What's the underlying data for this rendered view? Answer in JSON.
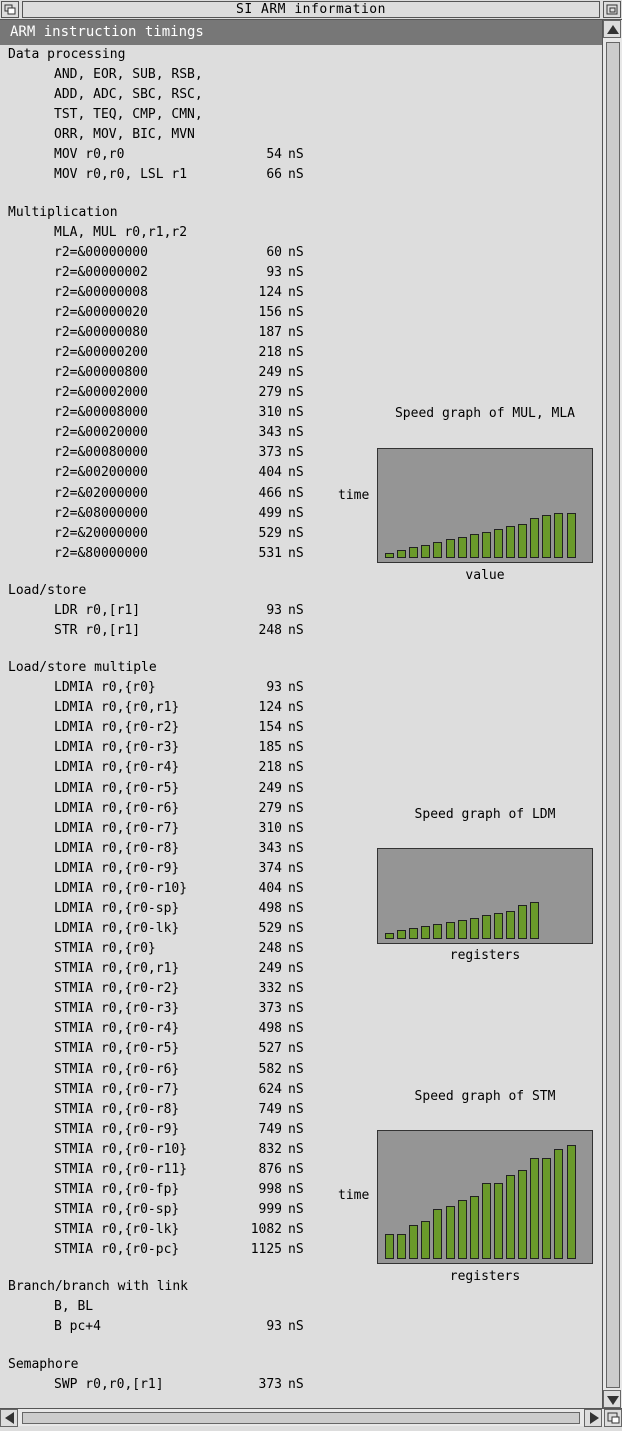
{
  "window": {
    "title": "SI ARM information"
  },
  "header": "ARM instruction timings",
  "unit": "nS",
  "sections": [
    {
      "title": "Data processing",
      "lines": [
        "AND, EOR, SUB, RSB,",
        "ADD, ADC, SBC, RSC,",
        "TST, TEQ, CMP, CMN,",
        "ORR, MOV, BIC, MVN"
      ],
      "rows": [
        {
          "label": "MOV r0,r0",
          "value": "54"
        },
        {
          "label": "MOV r0,r0, LSL r1",
          "value": "66"
        }
      ]
    },
    {
      "title": "Multiplication",
      "lines": [
        "MLA, MUL r0,r1,r2"
      ],
      "rows": [
        {
          "label": "r2=&00000000",
          "value": "60"
        },
        {
          "label": "r2=&00000002",
          "value": "93"
        },
        {
          "label": "r2=&00000008",
          "value": "124"
        },
        {
          "label": "r2=&00000020",
          "value": "156"
        },
        {
          "label": "r2=&00000080",
          "value": "187"
        },
        {
          "label": "r2=&00000200",
          "value": "218"
        },
        {
          "label": "r2=&00000800",
          "value": "249"
        },
        {
          "label": "r2=&00002000",
          "value": "279"
        },
        {
          "label": "r2=&00008000",
          "value": "310"
        },
        {
          "label": "r2=&00020000",
          "value": "343"
        },
        {
          "label": "r2=&00080000",
          "value": "373"
        },
        {
          "label": "r2=&00200000",
          "value": "404"
        },
        {
          "label": "r2=&02000000",
          "value": "466"
        },
        {
          "label": "r2=&08000000",
          "value": "499"
        },
        {
          "label": "r2=&20000000",
          "value": "529"
        },
        {
          "label": "r2=&80000000",
          "value": "531"
        }
      ]
    },
    {
      "title": "Load/store",
      "lines": [],
      "rows": [
        {
          "label": "LDR r0,[r1]",
          "value": "93"
        },
        {
          "label": "STR r0,[r1]",
          "value": "248"
        }
      ]
    },
    {
      "title": "Load/store multiple",
      "lines": [],
      "rows": [
        {
          "label": "LDMIA r0,{r0}",
          "value": "93"
        },
        {
          "label": "LDMIA r0,{r0,r1}",
          "value": "124"
        },
        {
          "label": "LDMIA r0,{r0-r2}",
          "value": "154"
        },
        {
          "label": "LDMIA r0,{r0-r3}",
          "value": "185"
        },
        {
          "label": "LDMIA r0,{r0-r4}",
          "value": "218"
        },
        {
          "label": "LDMIA r0,{r0-r5}",
          "value": "249"
        },
        {
          "label": "LDMIA r0,{r0-r6}",
          "value": "279"
        },
        {
          "label": "LDMIA r0,{r0-r7}",
          "value": "310"
        },
        {
          "label": "LDMIA r0,{r0-r8}",
          "value": "343"
        },
        {
          "label": "LDMIA r0,{r0-r9}",
          "value": "374"
        },
        {
          "label": "LDMIA r0,{r0-r10}",
          "value": "404"
        },
        {
          "label": "LDMIA r0,{r0-sp}",
          "value": "498"
        },
        {
          "label": "LDMIA r0,{r0-lk}",
          "value": "529"
        },
        {
          "label": "STMIA r0,{r0}",
          "value": "248"
        },
        {
          "label": "STMIA r0,{r0,r1}",
          "value": "249"
        },
        {
          "label": "STMIA r0,{r0-r2}",
          "value": "332"
        },
        {
          "label": "STMIA r0,{r0-r3}",
          "value": "373"
        },
        {
          "label": "STMIA r0,{r0-r4}",
          "value": "498"
        },
        {
          "label": "STMIA r0,{r0-r5}",
          "value": "527"
        },
        {
          "label": "STMIA r0,{r0-r6}",
          "value": "582"
        },
        {
          "label": "STMIA r0,{r0-r7}",
          "value": "624"
        },
        {
          "label": "STMIA r0,{r0-r8}",
          "value": "749"
        },
        {
          "label": "STMIA r0,{r0-r9}",
          "value": "749"
        },
        {
          "label": "STMIA r0,{r0-r10}",
          "value": "832"
        },
        {
          "label": "STMIA r0,{r0-r11}",
          "value": "876"
        },
        {
          "label": "STMIA r0,{r0-fp}",
          "value": "998"
        },
        {
          "label": "STMIA r0,{r0-sp}",
          "value": "999"
        },
        {
          "label": "STMIA r0,{r0-lk}",
          "value": "1082"
        },
        {
          "label": "STMIA r0,{r0-pc}",
          "value": "1125"
        }
      ]
    },
    {
      "title": "Branch/branch with link",
      "lines": [
        "B, BL"
      ],
      "rows": [
        {
          "label": "B pc+4",
          "value": "93"
        }
      ]
    },
    {
      "title": "Semaphore",
      "lines": [],
      "rows": [
        {
          "label": "SWP r0,r0,[r1]",
          "value": "373"
        }
      ]
    }
  ],
  "graphs": [
    {
      "title": "Speed graph of MUL, MLA",
      "ylabel": "time",
      "xlabel": "value",
      "bar_color": "#6a9a2a",
      "bars": [
        60,
        93,
        124,
        156,
        187,
        218,
        249,
        279,
        310,
        343,
        373,
        404,
        466,
        499,
        529,
        531
      ]
    },
    {
      "title": "Speed graph of LDM",
      "ylabel": "",
      "xlabel": "registers",
      "bar_color": "#6a9a2a",
      "bars": [
        93,
        124,
        154,
        185,
        218,
        249,
        279,
        310,
        343,
        374,
        404,
        498,
        529
      ]
    },
    {
      "title": "Speed graph of STM",
      "ylabel": "time",
      "xlabel": "registers",
      "bar_color": "#6a9a2a",
      "bars": [
        248,
        249,
        332,
        373,
        498,
        527,
        582,
        624,
        749,
        749,
        832,
        876,
        998,
        999,
        1082,
        1125
      ]
    }
  ],
  "chart_data": [
    {
      "type": "bar",
      "title": "Speed graph of MUL, MLA",
      "xlabel": "value",
      "ylabel": "time",
      "values": [
        60,
        93,
        124,
        156,
        187,
        218,
        249,
        279,
        310,
        343,
        373,
        404,
        466,
        499,
        529,
        531
      ]
    },
    {
      "type": "bar",
      "title": "Speed graph of LDM",
      "xlabel": "registers",
      "ylabel": "",
      "values": [
        93,
        124,
        154,
        185,
        218,
        249,
        279,
        310,
        343,
        374,
        404,
        498,
        529
      ]
    },
    {
      "type": "bar",
      "title": "Speed graph of STM",
      "xlabel": "registers",
      "ylabel": "time",
      "values": [
        248,
        249,
        332,
        373,
        498,
        527,
        582,
        624,
        749,
        749,
        832,
        876,
        998,
        999,
        1082,
        1125
      ]
    }
  ]
}
